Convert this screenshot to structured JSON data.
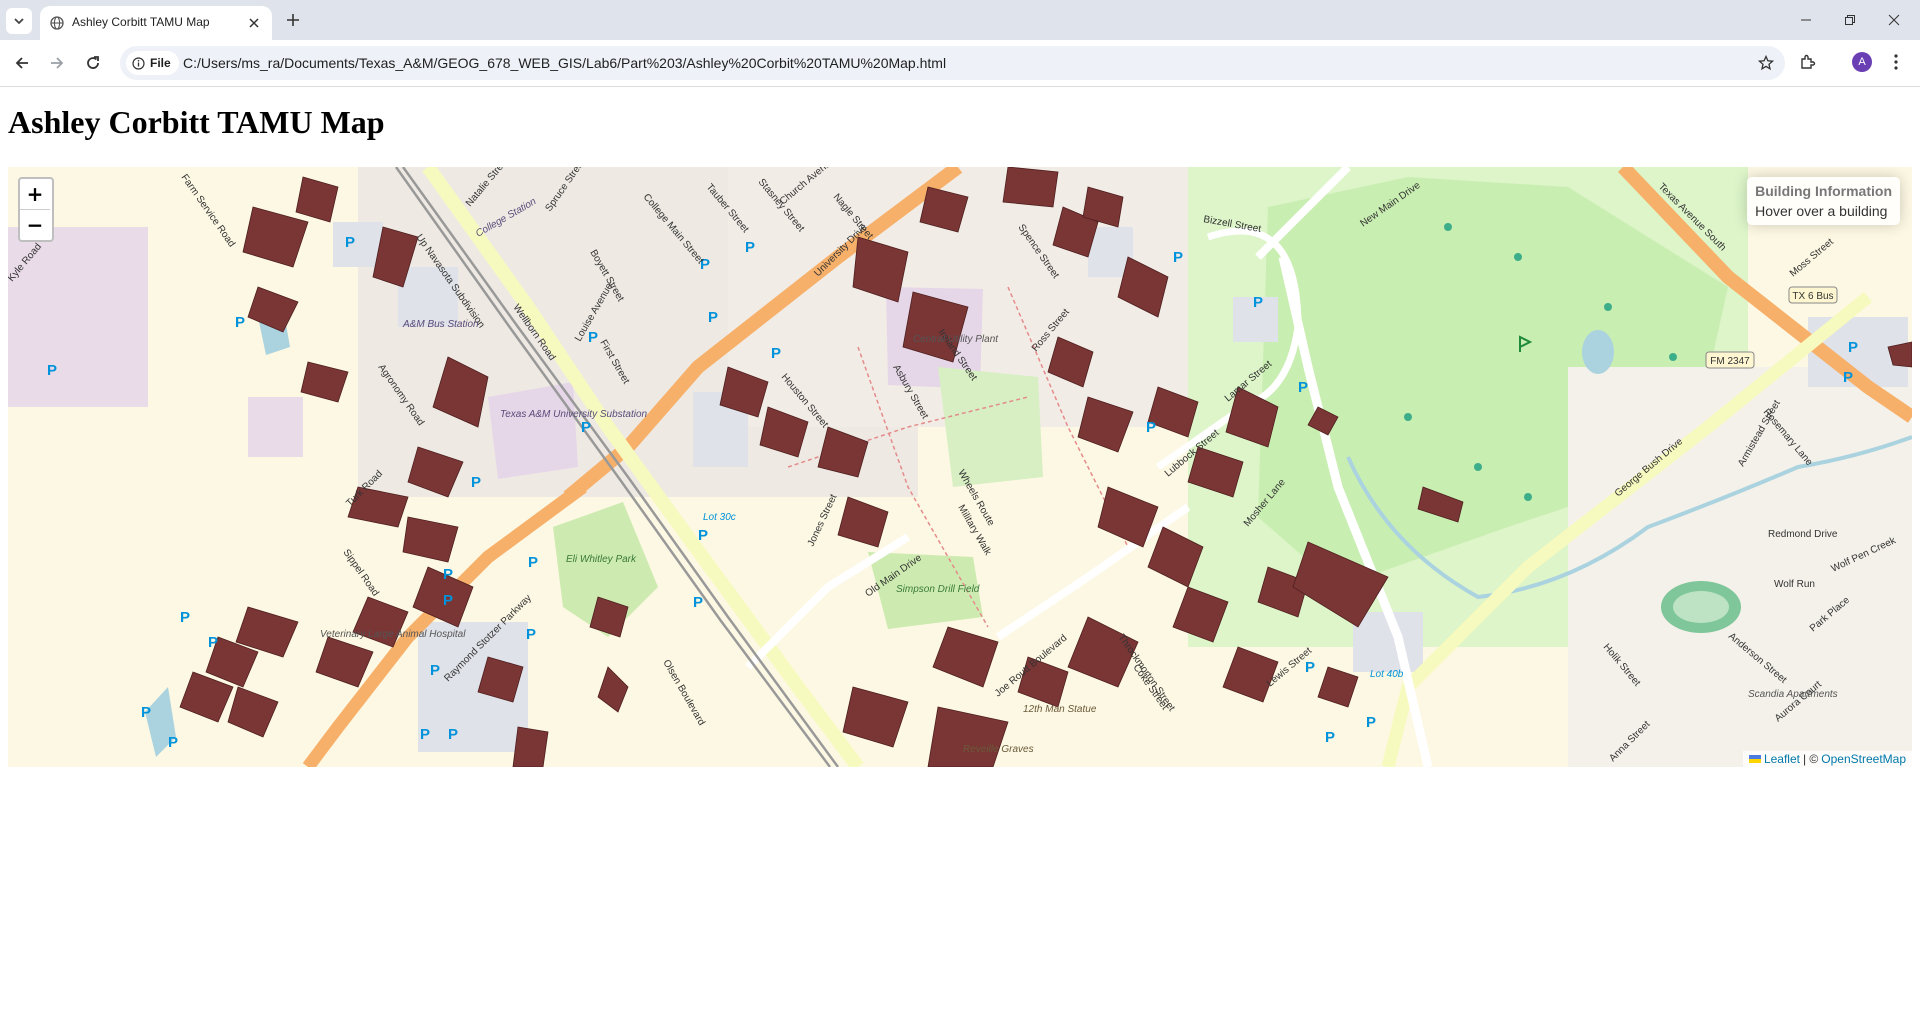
{
  "browser": {
    "tab_title": "Ashley Corbitt TAMU Map",
    "site_chip_label": "File",
    "url": "C:/Users/ms_ra/Documents/Texas_A&M/GEOG_678_WEB_GIS/Lab6/Part%203/Ashley%20Corbit%20TAMU%20Map.html",
    "profile_initial": "A",
    "icons": [
      "tab-list-icon",
      "favicon-globe-icon",
      "close-tab-icon",
      "new-tab-icon",
      "minimize-icon",
      "restore-icon",
      "window-close-icon",
      "back-icon",
      "forward-icon",
      "reload-icon",
      "info-icon",
      "bookmark-star-icon",
      "extensions-icon",
      "kebab-menu-icon"
    ]
  },
  "page": {
    "title": "Ashley Corbitt TAMU Map"
  },
  "map": {
    "zoom_in": "+",
    "zoom_out": "−",
    "info_control": {
      "title": "Building Information",
      "message": "Hover over a building"
    },
    "attribution": {
      "leaflet": "Leaflet",
      "separator": "| ©",
      "osm": "OpenStreetMap"
    },
    "colors": {
      "land": "#fdf8e3",
      "building_highlight": "#7a3535",
      "campus_zone": "#eeeae3",
      "park": "#cdebb0",
      "golf": "#ddf5c9",
      "parking": "#dfe2e8",
      "major_road": "#f7b06a",
      "secondary_road": "#f7fabf",
      "water": "#aad3df",
      "rail": "#999999"
    },
    "street_labels": [
      "Farm Service Road",
      "Natalie Street",
      "Spruce Street",
      "College Main Street",
      "Tauber Street",
      "Stasney Street",
      "Church Avenue",
      "Nagle Street",
      "University Drive",
      "Boyett Street",
      "Louise Avenue",
      "First Street",
      "Wellborn Road",
      "Agronomy Road",
      "Houston Street",
      "Asbury Street",
      "Ireland Street",
      "Ross Street",
      "Spence Street",
      "Bizzell Street",
      "New Main Drive",
      "Texas Avenue South",
      "Moss Street",
      "TX 6 Bus",
      "FM 2347",
      "George Bush Drive",
      "Rosemary Lane",
      "John Millift Road",
      "Armistead Street",
      "Redmond Drive",
      "Wolf Run",
      "Wolf Pen Creek",
      "Park Place",
      "Anderson Street",
      "Aurora Court",
      "Holik Street",
      "Anna Street",
      "Lamar Street",
      "Lubbock Street",
      "Mosher Lane",
      "Coke Street",
      "Lewis Street",
      "Throckmorton Street",
      "Joe Routt Boulevard",
      "Old Main Drive",
      "Olsen Boulevard",
      "Jones Street",
      "Wheels Route",
      "Military Walk",
      "Raymond Stotzer Parkway",
      "Turk Road",
      "Sippel Road",
      "Up Navasota Subdivision",
      "Kyle Road"
    ],
    "place_labels": [
      "College Station",
      "A&M Bus Station",
      "Texas A&M University Substation",
      "Lot 30c",
      "Eli Whitley Park",
      "Simpson Drill Field",
      "12th Man Statue",
      "Reveille Graves",
      "Lot 40b",
      "Scandia Apartments",
      "Veterinary Large Animal Hospital",
      "Central Utility Plant"
    ]
  }
}
